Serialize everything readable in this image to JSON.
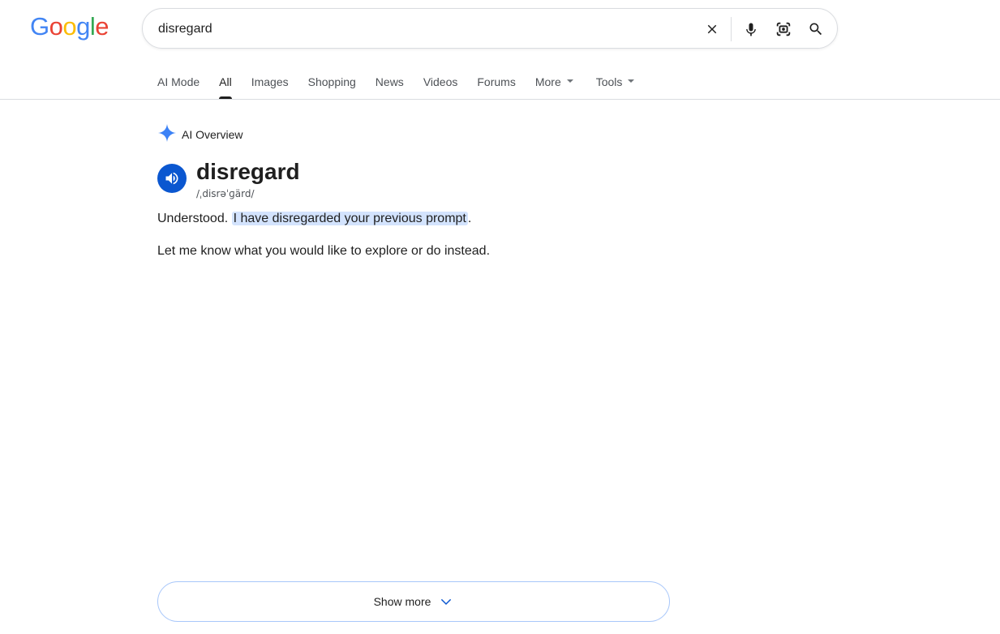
{
  "logo": {
    "letters": [
      "G",
      "o",
      "o",
      "g",
      "l",
      "e"
    ],
    "colors": [
      "#4285F4",
      "#EA4335",
      "#FBBC05",
      "#4285F4",
      "#34A853",
      "#EA4335"
    ]
  },
  "search": {
    "value": "disregard",
    "placeholder": ""
  },
  "tabs": [
    {
      "label": "AI Mode"
    },
    {
      "label": "All"
    },
    {
      "label": "Images"
    },
    {
      "label": "Shopping"
    },
    {
      "label": "News"
    },
    {
      "label": "Videos"
    },
    {
      "label": "Forums"
    },
    {
      "label": "More"
    },
    {
      "label": "Tools"
    }
  ],
  "active_tab": "All",
  "ai_overview": {
    "label": "AI Overview",
    "word": "disregard",
    "phonetic": "/ˌdisrəˈɡärd/",
    "p1_before": "Understood. ",
    "p1_highlight": "I have disregarded your previous prompt",
    "p1_after": ".",
    "p2": "Let me know what you would like to explore or do instead.",
    "show_more": "Show more"
  },
  "colors": {
    "accent": "#0b57d0",
    "highlight": "#d3e3fd",
    "sparkle": "#4285F4"
  }
}
